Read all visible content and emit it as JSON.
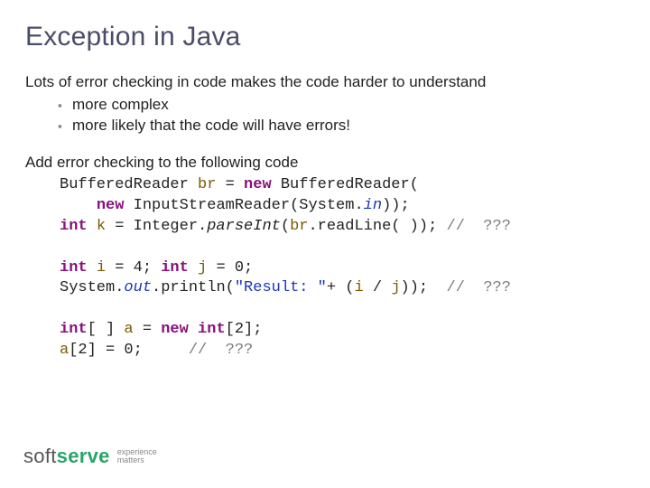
{
  "title": "Exception in Java",
  "lead": "Lots of error checking in code makes the code harder to understand",
  "bullets": [
    "more complex",
    "more likely that the code will have errors!"
  ],
  "lead2": "Add error checking to the following code",
  "code": {
    "l1_a": "BufferedReader ",
    "l1_var": "br",
    "l1_b": " = ",
    "l1_kw": "new",
    "l1_c": " BufferedReader(",
    "l2_pad": "    ",
    "l2_kw": "new",
    "l2_a": " InputStreamReader(System.",
    "l2_stat": "in",
    "l2_b": "));",
    "l3_kw": "int",
    "l3_a": " ",
    "l3_var": "k",
    "l3_b": " = Integer.",
    "l3_mth": "parseInt",
    "l3_c": "(",
    "l3_var2": "br",
    "l3_d": ".readLine( )); ",
    "l3_cmt": "//  ???",
    "l5_kw1": "int",
    "l5_a": " ",
    "l5_var1": "i",
    "l5_b": " = 4; ",
    "l5_kw2": "int",
    "l5_c": " ",
    "l5_var2": "j",
    "l5_d": " = 0;",
    "l6_a": "System.",
    "l6_stat": "out",
    "l6_b": ".println(",
    "l6_str": "\"Result: \"",
    "l6_c": "+ (",
    "l6_var1": "i",
    "l6_d": " / ",
    "l6_var2": "j",
    "l6_e": "));  ",
    "l6_cmt": "//  ???",
    "l8_kw1": "int",
    "l8_a": "[ ] ",
    "l8_var": "a",
    "l8_b": " = ",
    "l8_kw2": "new int",
    "l8_c": "[2];",
    "l9_var": "a",
    "l9_a": "[2] = 0;     ",
    "l9_cmt": "//  ???"
  },
  "logo": {
    "soft": "soft",
    "serve": "serve",
    "tag1": "experience",
    "tag2": "matters"
  }
}
